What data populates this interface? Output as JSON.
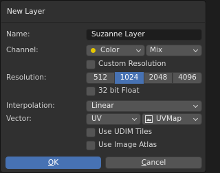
{
  "title": "New Layer",
  "name": {
    "label": "Name:",
    "value": "Suzanne Layer"
  },
  "channel": {
    "label": "Channel:",
    "value": "Color",
    "blend": "Mix",
    "dot_color": "#e6c700"
  },
  "custom_resolution": {
    "label": "Custom Resolution",
    "checked": false
  },
  "resolution": {
    "label": "Resolution:",
    "options": [
      "512",
      "1024",
      "2048",
      "4096"
    ],
    "selected": "1024"
  },
  "float32": {
    "label": "32 bit Float",
    "checked": false
  },
  "interpolation": {
    "label": "Interpolation:",
    "value": "Linear"
  },
  "vector": {
    "label": "Vector:",
    "value": "UV",
    "map": "UVMap"
  },
  "use_udim": {
    "label": "Use UDIM Tiles",
    "checked": false
  },
  "use_atlas": {
    "label": "Use Image Atlas",
    "checked": false
  },
  "buttons": {
    "ok_first": "O",
    "ok_rest": "K",
    "cancel_first": "C",
    "cancel_rest": "ancel"
  },
  "colors": {
    "accent": "#4772b3",
    "panel": "#303030",
    "field": "#545454"
  }
}
